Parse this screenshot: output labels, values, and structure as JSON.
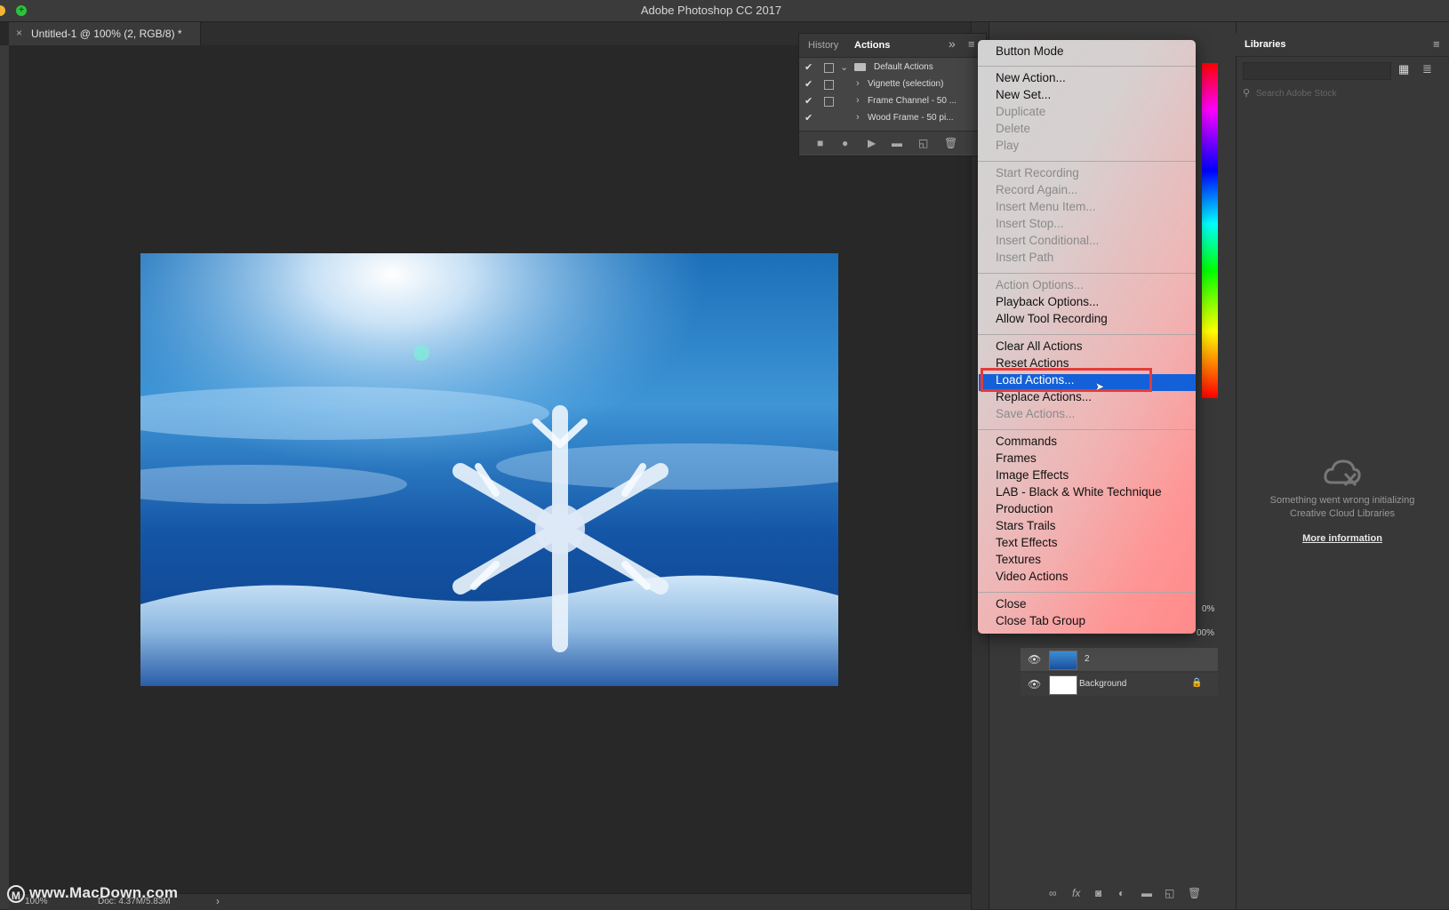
{
  "window": {
    "title": "Adobe Photoshop CC 2017"
  },
  "document_tab": {
    "close_glyph": "×",
    "label": "Untitled-1 @ 100% (2, RGB/8) *"
  },
  "actions_panel": {
    "tabs": [
      "History",
      "Actions"
    ],
    "expand_glyph": "»",
    "rows": [
      {
        "checked": "✔",
        "name": "Default Actions",
        "kind": "set",
        "expander": "⌄"
      },
      {
        "checked": "✔",
        "name": "Vignette (selection)",
        "kind": "action",
        "expander": "›"
      },
      {
        "checked": "✔",
        "name": "Frame Channel - 50 ...",
        "kind": "action",
        "expander": "›"
      },
      {
        "checked": "✔",
        "name": "Wood Frame - 50 pi...",
        "kind": "action",
        "expander": "›"
      }
    ],
    "footer_icons": [
      "stop-icon",
      "record-icon",
      "play-icon",
      "folder-icon",
      "new-action-icon",
      "trash-icon"
    ]
  },
  "flyout_menu": {
    "groups": [
      [
        {
          "label": "Button Mode",
          "enabled": true
        }
      ],
      [
        {
          "label": "New Action...",
          "enabled": true
        },
        {
          "label": "New Set...",
          "enabled": true
        },
        {
          "label": "Duplicate",
          "enabled": false
        },
        {
          "label": "Delete",
          "enabled": false
        },
        {
          "label": "Play",
          "enabled": false
        }
      ],
      [
        {
          "label": "Start Recording",
          "enabled": false
        },
        {
          "label": "Record Again...",
          "enabled": false
        },
        {
          "label": "Insert Menu Item...",
          "enabled": false
        },
        {
          "label": "Insert Stop...",
          "enabled": false
        },
        {
          "label": "Insert Conditional...",
          "enabled": false
        },
        {
          "label": "Insert Path",
          "enabled": false
        }
      ],
      [
        {
          "label": "Action Options...",
          "enabled": false
        },
        {
          "label": "Playback Options...",
          "enabled": true
        },
        {
          "label": "Allow Tool Recording",
          "enabled": true
        }
      ],
      [
        {
          "label": "Clear All Actions",
          "enabled": true
        },
        {
          "label": "Reset Actions",
          "enabled": true
        },
        {
          "label": "Load Actions...",
          "enabled": true,
          "highlighted": true
        },
        {
          "label": "Replace Actions...",
          "enabled": true
        },
        {
          "label": "Save Actions...",
          "enabled": false
        }
      ],
      [
        {
          "label": "Commands",
          "enabled": true
        },
        {
          "label": "Frames",
          "enabled": true
        },
        {
          "label": "Image Effects",
          "enabled": true
        },
        {
          "label": "LAB - Black & White Technique",
          "enabled": true
        },
        {
          "label": "Production",
          "enabled": true
        },
        {
          "label": "Stars Trails",
          "enabled": true
        },
        {
          "label": "Text Effects",
          "enabled": true
        },
        {
          "label": "Textures",
          "enabled": true
        },
        {
          "label": "Video Actions",
          "enabled": true
        }
      ],
      [
        {
          "label": "Close",
          "enabled": true
        },
        {
          "label": "Close Tab Group",
          "enabled": true
        }
      ]
    ],
    "highlight_color": "#1460d8",
    "annotation_box_color": "#e33b3b"
  },
  "layers_panel": {
    "opacity_partial": "0%",
    "fill_partial": "00%",
    "layers": [
      {
        "name": "2",
        "visible_glyph": "👁"
      },
      {
        "name": "Background",
        "visible_glyph": "👁",
        "lock_glyph": "🔒"
      }
    ]
  },
  "libraries_panel": {
    "tab": "Libraries",
    "search_placeholder": "Search Adobe Stock",
    "error_line1": "Something went wrong initializing",
    "error_line2": "Creative Cloud Libraries",
    "more_info": "More information"
  },
  "status_bar": {
    "zoom": "100%",
    "doc_info": "Doc: 4.37M/5.83M",
    "arrow": "›"
  },
  "watermark": "www.MacDown.com"
}
